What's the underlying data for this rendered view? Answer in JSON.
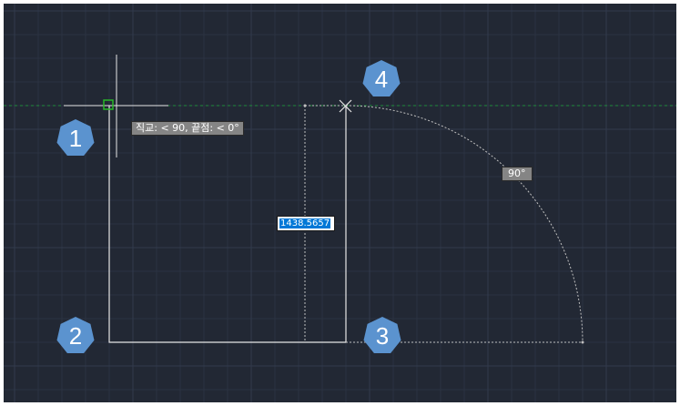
{
  "viewport": {
    "background_color": "#222834",
    "grid_color": "#2b3242",
    "grid_major_color": "#323a4c",
    "line_color": "#e6e6e6",
    "dashed_line_color": "#bfbfbf",
    "tracking_line_color": "#1f8a3a",
    "marker_color": "#28b828"
  },
  "tooltip": {
    "ortho_text": "직교: < 90,  끝점: < 0°"
  },
  "dimension": {
    "input_value": "1438.5657",
    "angle_label": "90°"
  },
  "callouts": {
    "color": "#5b93cf",
    "c1": "1",
    "c2": "2",
    "c3": "3",
    "c4": "4"
  }
}
